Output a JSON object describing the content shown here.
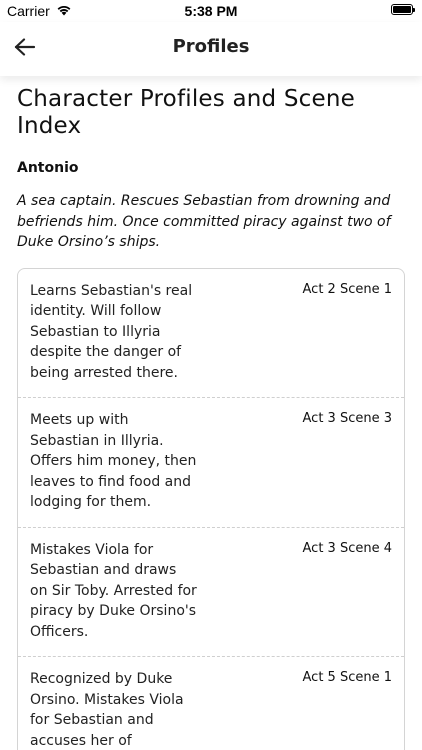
{
  "status_bar": {
    "carrier": "Carrier",
    "time": "5:38 PM",
    "battery_level": 1.0
  },
  "nav": {
    "title": "Profiles",
    "back_icon": "arrow-left-icon"
  },
  "page": {
    "title": "Character Profiles and Scene Index"
  },
  "character": {
    "name": "Antonio",
    "description": "A sea captain. Rescues Sebastian from drowning and befriends him. Once committed piracy against two of Duke Orsino’s ships."
  },
  "scenes": [
    {
      "text": "Learns Sebastian's real identity. Will follow Sebastian to Illyria despite the danger of being arrested there.",
      "ref": "Act 2 Scene 1"
    },
    {
      "text": "Meets up with Sebastian in Illyria. Offers him money, then leaves to find food and lodging for them.",
      "ref": "Act 3 Scene 3"
    },
    {
      "text": "Mistakes Viola for Sebastian and draws on Sir Toby. Arrested for piracy by Duke Orsino's Officers.",
      "ref": "Act 3 Scene 4"
    },
    {
      "text": "Recognized by Duke Orsino. Mistakes Viola for Sebastian and accuses her of disloyalty.",
      "ref": "Act 5 Scene 1"
    }
  ]
}
